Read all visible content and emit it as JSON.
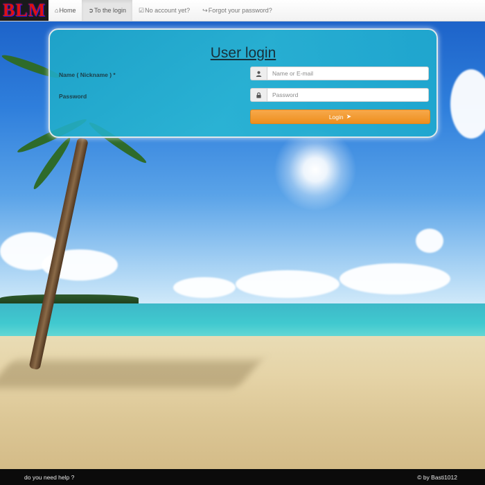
{
  "brand": {
    "logo_text": "BLM"
  },
  "nav": {
    "items": [
      {
        "icon": "home-icon",
        "label": "Home"
      },
      {
        "icon": "login-icon",
        "label": "To the login"
      },
      {
        "icon": "checkbox-icon",
        "label": "No account yet?"
      },
      {
        "icon": "logout-icon",
        "label": "Forgot your password?"
      }
    ],
    "active": "To the login"
  },
  "login": {
    "title": "User login",
    "name_label": "Name ( Nickname ) *",
    "name_placeholder": "Name or E-mail",
    "password_label": "Password",
    "password_placeholder": "Password",
    "button_label": "Login",
    "user_icon": "user-icon",
    "lock_icon": "lock-icon",
    "send_icon": "paper-plane-icon"
  },
  "footer": {
    "help_text": "do you need help ?",
    "copyright": "© by Basti1012"
  },
  "colors": {
    "accent_button": "#f0961f",
    "panel": "#1fb0cc",
    "brand_text": "#e01010",
    "footer_bg": "#0b0b0b"
  }
}
